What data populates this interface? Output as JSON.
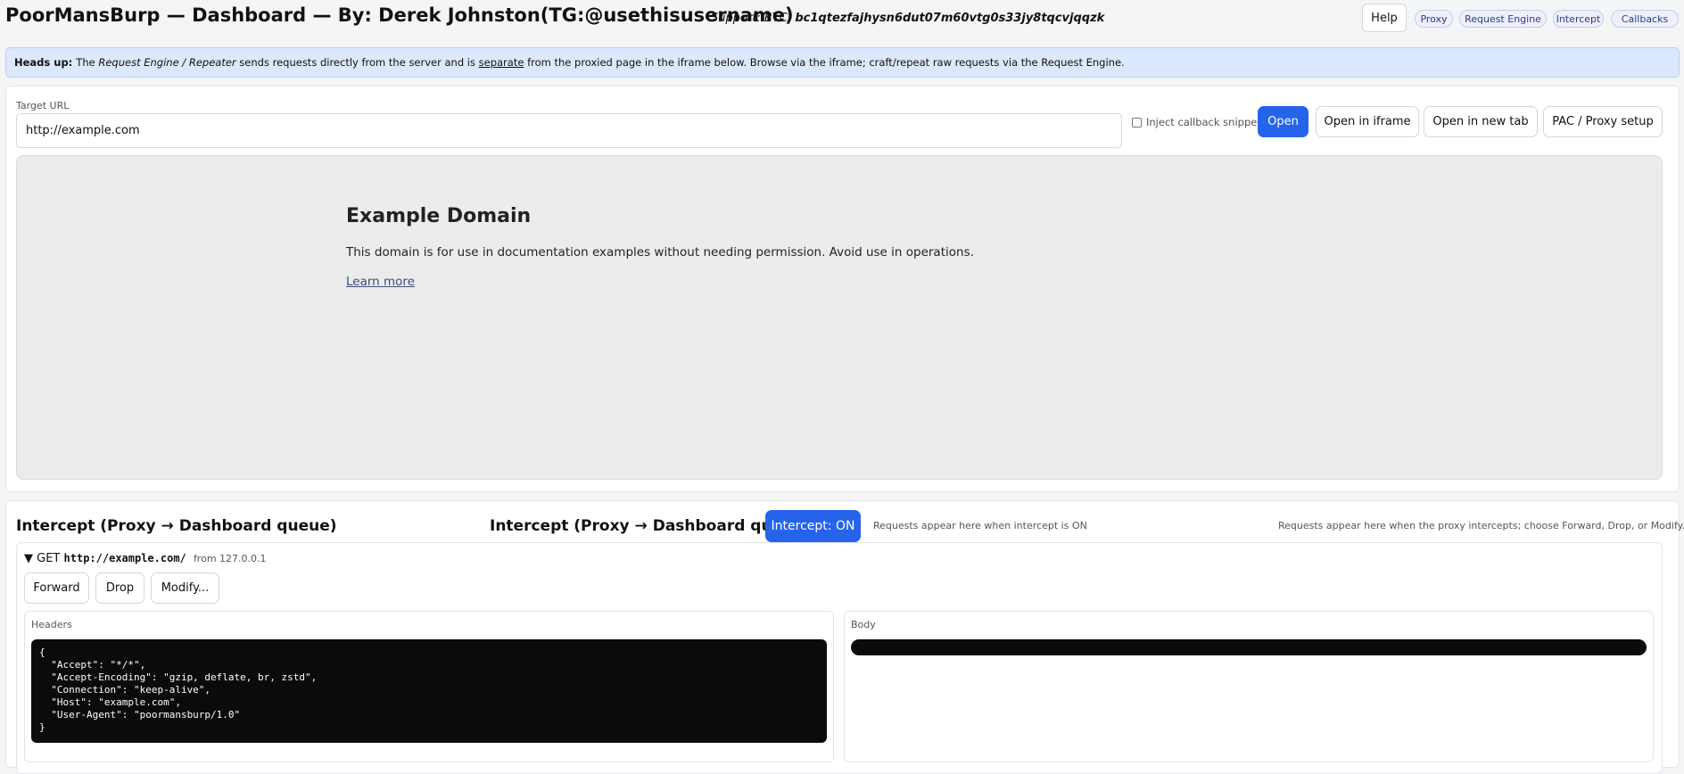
{
  "header": {
    "title": "PoorMansBurp — Dashboard — By: Derek Johnston(TG:@usethisusername)",
    "support_prefix": "Support: BTC:",
    "support_address": "bc1qtezfajhysn6dut07m60vtg0s33jy8tqcvjqqzk",
    "help_label": "Help",
    "nav": [
      "Proxy",
      "Request Engine",
      "Intercept",
      "Callbacks"
    ]
  },
  "banner": {
    "lead": "Heads up:",
    "t1": "The",
    "engine": "Request Engine / Repeater",
    "t2": "sends requests directly from the server and is",
    "separate": "separate",
    "t3": "from the proxied page in the iframe below. Browse via the iframe; craft/repeat raw requests via the Request Engine."
  },
  "target": {
    "label": "Target URL",
    "value": "http://example.com",
    "inject_label": "Inject callback snippet",
    "inject_checked": false,
    "buttons": {
      "open": "Open",
      "open_iframe": "Open in iframe",
      "open_new_tab": "Open in new tab",
      "pac": "PAC / Proxy setup"
    }
  },
  "iframe": {
    "heading": "Example Domain",
    "text": "This domain is for use in documentation examples without needing permission. Avoid use in operations.",
    "link": "Learn more"
  },
  "intercept": {
    "title": "Intercept (Proxy → Dashboard queue)",
    "title_2": "Intercept (Proxy → Dashboard queue)",
    "toggle_label": "Intercept: ON",
    "note_left": "Requests appear here when intercept is ON",
    "note_right": "Requests appear here when the proxy intercepts; choose Forward, Drop, or Modify.",
    "request": {
      "arrow": "▼",
      "method": "GET",
      "url": "http://example.com/",
      "from": "from 127.0.0.1",
      "actions": {
        "forward": "Forward",
        "drop": "Drop",
        "modify": "Modify..."
      },
      "headers_label": "Headers",
      "headers_json": "{\n  \"Accept\": \"*/*\",\n  \"Accept-Encoding\": \"gzip, deflate, br, zstd\",\n  \"Connection\": \"keep-alive\",\n  \"Host\": \"example.com\",\n  \"User-Agent\": \"poormansburp/1.0\"\n}",
      "body_label": "Body",
      "body": ""
    }
  },
  "colors": {
    "accent": "#2563eb",
    "banner_bg": "#dbe8fd",
    "code_bg": "#0b0b0b"
  }
}
